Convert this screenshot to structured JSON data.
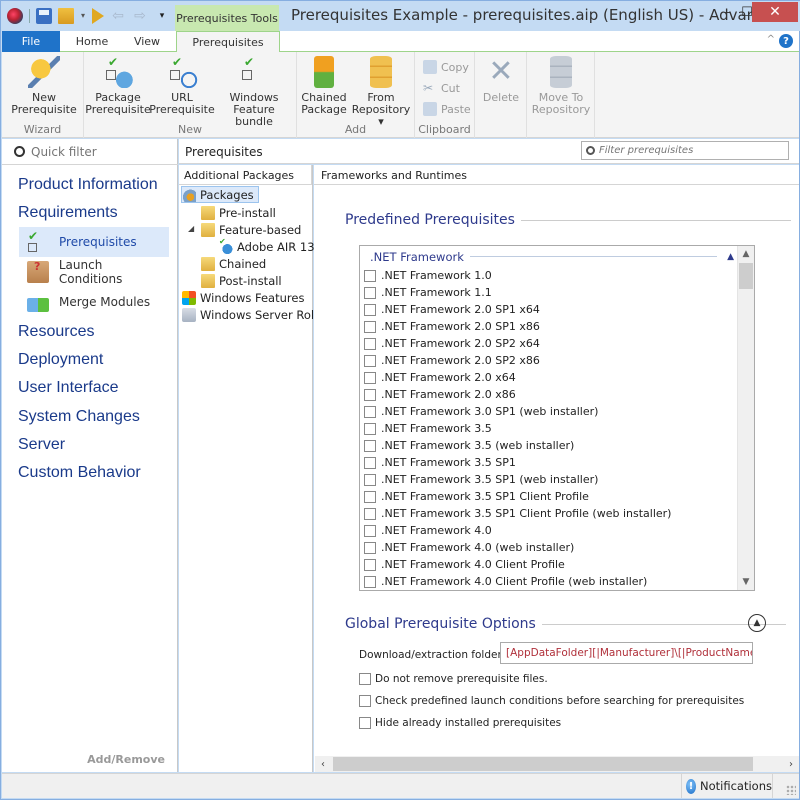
{
  "window": {
    "title": "Prerequisites Example - prerequisites.aip (English US) - Advanc...",
    "contextual_tab_group": "Prerequisites Tools",
    "controls": {
      "minimize": "–",
      "maximize": "☐",
      "close": "✕"
    }
  },
  "quick_access": {
    "icons": [
      "app-icon",
      "save-icon",
      "build-icon",
      "dropdown-icon",
      "run-icon",
      "back-icon",
      "forward-icon",
      "customize-icon"
    ]
  },
  "ribbon": {
    "tabs": [
      {
        "label": "File",
        "active": false
      },
      {
        "label": "Home",
        "active": false
      },
      {
        "label": "View",
        "active": false
      },
      {
        "label": "Prerequisites",
        "active": true
      }
    ],
    "help_label": "?",
    "groups": [
      {
        "label": "Wizard",
        "buttons": [
          {
            "label_line1": "New",
            "label_line2": "Prerequisite",
            "icon": "wand-icon",
            "enabled": true
          }
        ]
      },
      {
        "label": "New",
        "buttons": [
          {
            "label_line1": "Package",
            "label_line2": "Prerequisite",
            "icon": "package-prerequisite-icon",
            "enabled": true
          },
          {
            "label_line1": "URL",
            "label_line2": "Prerequisite",
            "icon": "url-prerequisite-icon",
            "enabled": true
          },
          {
            "label_line1": "Windows",
            "label_line2": "Feature bundle",
            "icon": "windows-feature-icon",
            "enabled": true
          }
        ]
      },
      {
        "label": "Add",
        "buttons": [
          {
            "label_line1": "Chained",
            "label_line2": "Package",
            "icon": "chained-package-icon",
            "enabled": true
          },
          {
            "label_line1": "From",
            "label_line2": "Repository ▾",
            "icon": "repository-icon",
            "enabled": true
          }
        ]
      },
      {
        "label": "Clipboard",
        "buttons": [
          {
            "label": "Copy",
            "icon": "copy-icon",
            "enabled": false
          },
          {
            "label": "Cut",
            "icon": "cut-icon",
            "enabled": false
          },
          {
            "label": "Paste",
            "icon": "paste-icon",
            "enabled": false
          }
        ]
      },
      {
        "label": "",
        "buttons": [
          {
            "label_line1": "Delete",
            "label_line2": "",
            "icon": "delete-icon",
            "enabled": false
          }
        ]
      },
      {
        "label": "",
        "buttons": [
          {
            "label_line1": "Move To",
            "label_line2": "Repository",
            "icon": "move-to-repository-icon",
            "enabled": false
          }
        ]
      }
    ]
  },
  "left_nav": {
    "quick_filter_placeholder": "Quick filter",
    "categories": [
      {
        "label": "Product Information"
      },
      {
        "label": "Requirements",
        "children": [
          {
            "label": "Prerequisites",
            "selected": true,
            "icon": "prerequisites-icon"
          },
          {
            "label": "Launch Conditions",
            "selected": false,
            "icon": "launch-conditions-icon"
          },
          {
            "label": "Merge Modules",
            "selected": false,
            "icon": "merge-modules-icon"
          }
        ]
      },
      {
        "label": "Resources"
      },
      {
        "label": "Deployment"
      },
      {
        "label": "User Interface"
      },
      {
        "label": "System Changes"
      },
      {
        "label": "Server"
      },
      {
        "label": "Custom Behavior"
      }
    ],
    "footer": "Add/Remove"
  },
  "page": {
    "header": "Prerequisites",
    "filter_placeholder": "Filter prerequisites"
  },
  "tree": {
    "header": "Additional Packages",
    "nodes": [
      {
        "label": "Packages",
        "level": 0,
        "icon": "packages-icon",
        "selected": true
      },
      {
        "label": "Pre-install",
        "level": 1,
        "icon": "folder-icon"
      },
      {
        "label": "Feature-based",
        "level": 1,
        "icon": "folder-icon",
        "expanded": true
      },
      {
        "label": "Adobe AIR 13",
        "level": 2,
        "icon": "prerequisite-item-icon"
      },
      {
        "label": "Chained",
        "level": 1,
        "icon": "folder-icon"
      },
      {
        "label": "Post-install",
        "level": 1,
        "icon": "folder-icon"
      },
      {
        "label": "Windows Features",
        "level": 0,
        "icon": "windows-features-icon"
      },
      {
        "label": "Windows Server Roles",
        "level": 0,
        "icon": "server-roles-icon"
      }
    ]
  },
  "content": {
    "header": "Frameworks and Runtimes",
    "predefined_title": "Predefined Prerequisites",
    "framework_group": {
      "title": ".NET Framework",
      "items": [
        {
          "label": ".NET Framework 1.0",
          "checked": false
        },
        {
          "label": ".NET Framework 1.1",
          "checked": false
        },
        {
          "label": ".NET Framework 2.0 SP1 x64",
          "checked": false
        },
        {
          "label": ".NET Framework 2.0 SP1 x86",
          "checked": false
        },
        {
          "label": ".NET Framework 2.0 SP2 x64",
          "checked": false
        },
        {
          "label": ".NET Framework 2.0 SP2 x86",
          "checked": false
        },
        {
          "label": ".NET Framework 2.0 x64",
          "checked": false
        },
        {
          "label": ".NET Framework 2.0 x86",
          "checked": false
        },
        {
          "label": ".NET Framework 3.0 SP1 (web installer)",
          "checked": false
        },
        {
          "label": ".NET Framework 3.5",
          "checked": false
        },
        {
          "label": ".NET Framework 3.5 (web installer)",
          "checked": false
        },
        {
          "label": ".NET Framework 3.5 SP1",
          "checked": false
        },
        {
          "label": ".NET Framework 3.5 SP1 (web installer)",
          "checked": false
        },
        {
          "label": ".NET Framework 3.5 SP1 Client Profile",
          "checked": false
        },
        {
          "label": ".NET Framework 3.5 SP1 Client Profile (web installer)",
          "checked": false
        },
        {
          "label": ".NET Framework 4.0",
          "checked": false
        },
        {
          "label": ".NET Framework 4.0 (web installer)",
          "checked": false
        },
        {
          "label": ".NET Framework 4.0 Client Profile",
          "checked": false
        },
        {
          "label": ".NET Framework 4.0 Client Profile (web installer)",
          "checked": false
        }
      ]
    },
    "global_options": {
      "title": "Global Prerequisite Options",
      "download_folder_label": "Download/extraction folder:",
      "download_folder_value": "[AppDataFolder][|Manufacturer]\\[|ProductName]\\prerequisites",
      "options": [
        {
          "label": "Do not remove prerequisite files.",
          "checked": false
        },
        {
          "label": "Check predefined launch conditions before searching for prerequisites",
          "checked": false
        },
        {
          "label": "Hide already installed prerequisites",
          "checked": false
        }
      ]
    }
  },
  "statusbar": {
    "notifications_label": "Notifications"
  },
  "colors": {
    "accent": "#1f73c9",
    "contextual_tab": "#c8e8b0",
    "nav_category": "#1a3a8a",
    "section_title": "#2e3a8c",
    "path_value": "#b0303a",
    "close_button": "#c75050",
    "selection": "#dce9fa"
  }
}
